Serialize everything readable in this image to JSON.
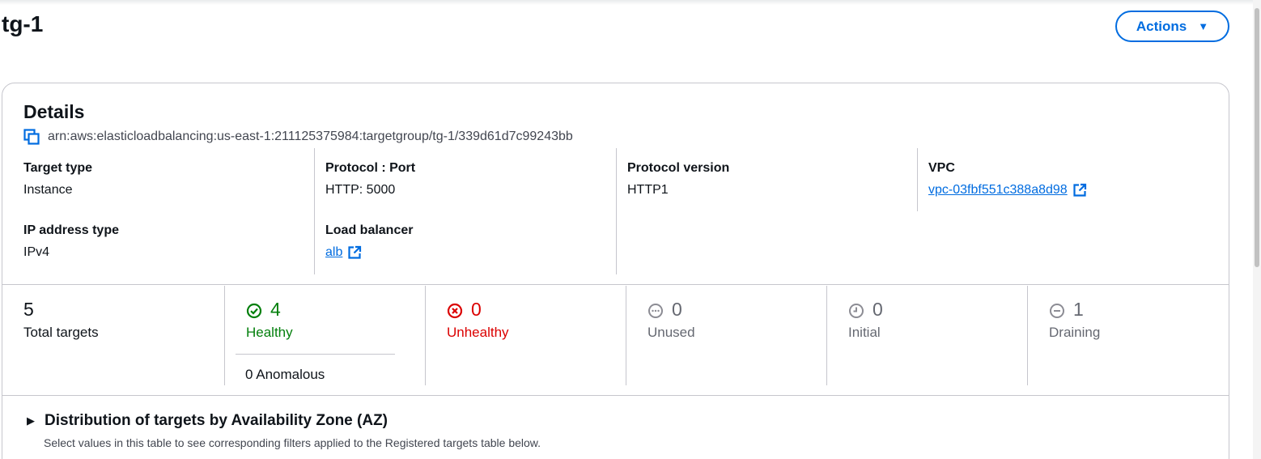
{
  "page": {
    "title": "tg-1",
    "actions_label": "Actions"
  },
  "details": {
    "heading": "Details",
    "arn": "arn:aws:elasticloadbalancing:us-east-1:211125375984:targetgroup/tg-1/339d61d7c99243bb",
    "fields": {
      "target_type": {
        "label": "Target type",
        "value": "Instance"
      },
      "ip_address_type": {
        "label": "IP address type",
        "value": "IPv4"
      },
      "protocol_port": {
        "label": "Protocol : Port",
        "value": "HTTP: 5000"
      },
      "load_balancer": {
        "label": "Load balancer",
        "value": "alb"
      },
      "protocol_version": {
        "label": "Protocol version",
        "value": "HTTP1"
      },
      "vpc": {
        "label": "VPC",
        "value": "vpc-03fbf551c388a8d98"
      }
    }
  },
  "targets": {
    "total": {
      "count": "5",
      "label": "Total targets"
    },
    "healthy": {
      "count": "4",
      "label": "Healthy",
      "color": "#037f0c"
    },
    "unhealthy": {
      "count": "0",
      "label": "Unhealthy",
      "color": "#db0000"
    },
    "unused": {
      "count": "0",
      "label": "Unused",
      "color": "#656871"
    },
    "initial": {
      "count": "0",
      "label": "Initial",
      "color": "#656871"
    },
    "draining": {
      "count": "1",
      "label": "Draining",
      "color": "#656871"
    },
    "anomalous": "0 Anomalous"
  },
  "distribution": {
    "title": "Distribution of targets by Availability Zone (AZ)",
    "description": "Select values in this table to see corresponding filters applied to the Registered targets table below."
  },
  "colors": {
    "accent": "#006ce0",
    "text": "#0f141a",
    "muted": "#656871",
    "border": "#c6c6cd"
  },
  "icons": [
    "copy-icon",
    "external-link-icon",
    "caret-down-icon",
    "status-success-icon",
    "status-error-icon",
    "status-unused-icon",
    "status-pending-icon",
    "status-stopped-icon",
    "caret-right-icon"
  ]
}
